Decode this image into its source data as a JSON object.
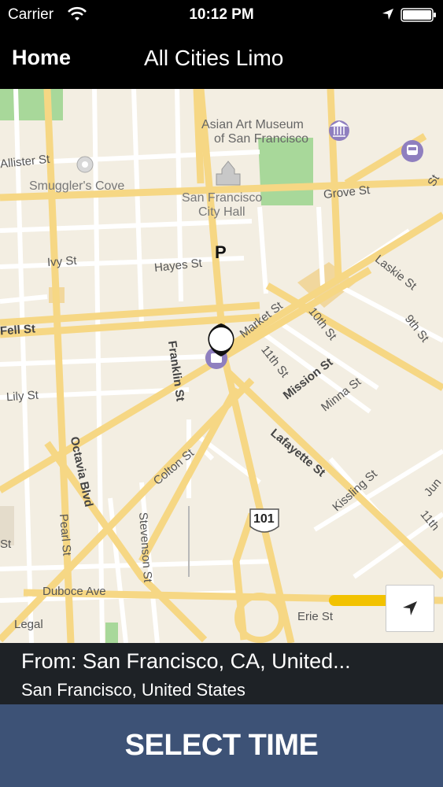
{
  "status_bar": {
    "carrier": "Carrier",
    "time": "10:12 PM"
  },
  "nav": {
    "back_label": "Home",
    "title": "All Cities Limo"
  },
  "map": {
    "labels": {
      "asian_art_1": "Asian Art Museum",
      "asian_art_2": "of San Francisco",
      "allister": "Allister St",
      "smugglers": "Smuggler's Cove",
      "city_hall_1": "San Francisco",
      "city_hall_2": "City Hall",
      "grove": "Grove St",
      "ivy": "Ivy St",
      "hayes": "Hayes St",
      "laskie": "Laskie St",
      "market": "Market St",
      "tenth": "10th St",
      "ninth": "9th St",
      "fell": "Fell St",
      "eleventh": "11th St",
      "franklin": "Franklin St",
      "mission": "Mission St",
      "minna": "Minna St",
      "lily": "Lily St",
      "lafayette": "Lafayette St",
      "octavia": "Octavia Blvd",
      "colton": "Colton St",
      "kissling": "Kissling St",
      "jun": "Jun",
      "route": "101",
      "pearl": "Pearl St",
      "stevenson": "Stevenson St",
      "eleventh2": "11th",
      "duboce": "Duboce Ave",
      "erie": "Erie St",
      "legal": "Legal",
      "st_left": "St",
      "st_right": "St",
      "pin_letter": "P"
    }
  },
  "address": {
    "from": "From: San Francisco, CA, United...",
    "sub": "San Francisco, United States"
  },
  "select_time_label": "SELECT TIME",
  "colors": {
    "nav_bg": "#000000",
    "map_bg": "#f3eee2",
    "road_major": "#f6d784",
    "road_minor": "#ffffff",
    "park": "#a8d89a",
    "button_bg": "#3d5276",
    "address_bg": "#1e2226",
    "poi": "#8f7fbf"
  }
}
